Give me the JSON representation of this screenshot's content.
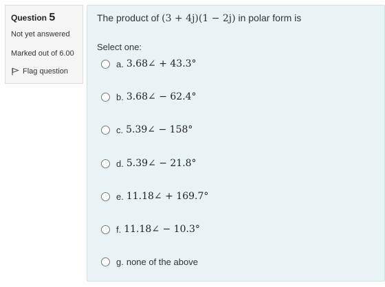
{
  "info": {
    "question_label": "Question",
    "question_number": "5",
    "state": "Not yet answered",
    "grade": "Marked out of 6.00",
    "flag_label": "Flag question"
  },
  "question": {
    "text_prefix": "The product of ",
    "expression": "(3 + 4j)(1 − 2j)",
    "text_suffix": " in polar form is",
    "prompt": "Select one:"
  },
  "options": [
    {
      "label": "a.",
      "value": "3.68∠ + 43.3°"
    },
    {
      "label": "b.",
      "value": "3.68∠ − 62.4°"
    },
    {
      "label": "c.",
      "value": "5.39∠ − 158°"
    },
    {
      "label": "d.",
      "value": "5.39∠ − 21.8°"
    },
    {
      "label": "e.",
      "value": "11.18∠ + 169.7°"
    },
    {
      "label": "f.",
      "value": "11.18∠ − 10.3°"
    },
    {
      "label": "g.",
      "value": "none of the above"
    }
  ]
}
